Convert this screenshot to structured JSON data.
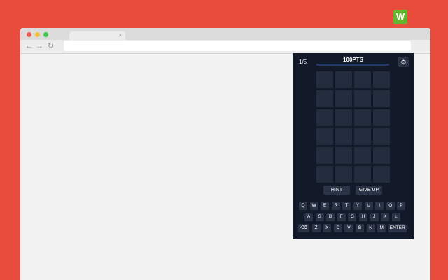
{
  "browser": {
    "tab": {
      "close_icon": "×"
    },
    "nav": {
      "back_icon": "←",
      "forward_icon": "→",
      "reload_icon": "↻"
    },
    "extension": {
      "label": "W",
      "color": "#62b52d"
    }
  },
  "game": {
    "round": "1/5",
    "points": "100PTS",
    "progress": 1.0,
    "settings_icon": "⚙",
    "grid": {
      "rows": 6,
      "cols": 4
    },
    "buttons": {
      "hint": "HINT",
      "give_up": "GIVE UP"
    },
    "keyboard": {
      "row1": [
        "Q",
        "W",
        "E",
        "R",
        "T",
        "Y",
        "U",
        "I",
        "O",
        "P"
      ],
      "row2": [
        "A",
        "S",
        "D",
        "F",
        "G",
        "H",
        "J",
        "K",
        "L"
      ],
      "row3": [
        "⌫",
        "Z",
        "X",
        "C",
        "V",
        "B",
        "N",
        "M",
        "ENTER"
      ]
    }
  },
  "colors": {
    "background": "#e84c3d",
    "panel": "#121a29",
    "cell": "#242d3e",
    "key": "#2b3447"
  }
}
